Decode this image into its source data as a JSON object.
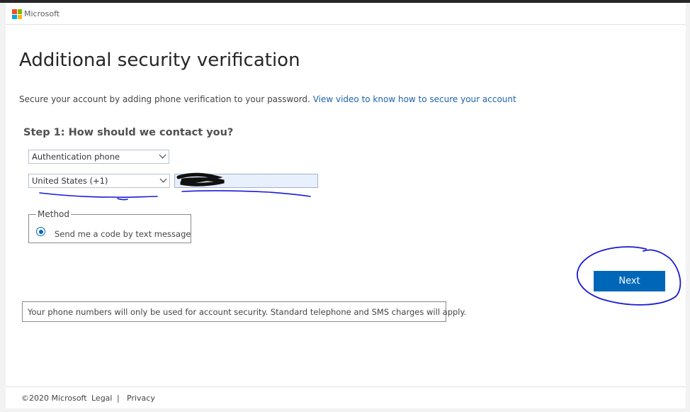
{
  "header": {
    "brand": "Microsoft",
    "logo_colors": [
      "#f25022",
      "#7fba00",
      "#00a4ef",
      "#ffb900"
    ]
  },
  "main": {
    "title": "Additional security verification",
    "intro_text": "Secure your account by adding phone verification to your password.",
    "intro_link": "View video to know how to secure your account",
    "step_title": "Step 1: How should we contact you?",
    "contact_method_select": "Authentication phone",
    "country_select": "United States (+1)",
    "phone_number_value": "",
    "method": {
      "legend": "Method",
      "option_label": "Send me a code by text message",
      "selected": true
    },
    "next_label": "Next",
    "notice": "Your phone numbers will only be used for account security. Standard telephone and SMS charges will apply."
  },
  "footer": {
    "copyright": "©2020 Microsoft",
    "legal": "Legal",
    "separator": "|",
    "privacy": "Privacy"
  },
  "colors": {
    "accent": "#0067b8",
    "link": "#1d62b0",
    "annotation_ink": "#1a1ad6"
  }
}
